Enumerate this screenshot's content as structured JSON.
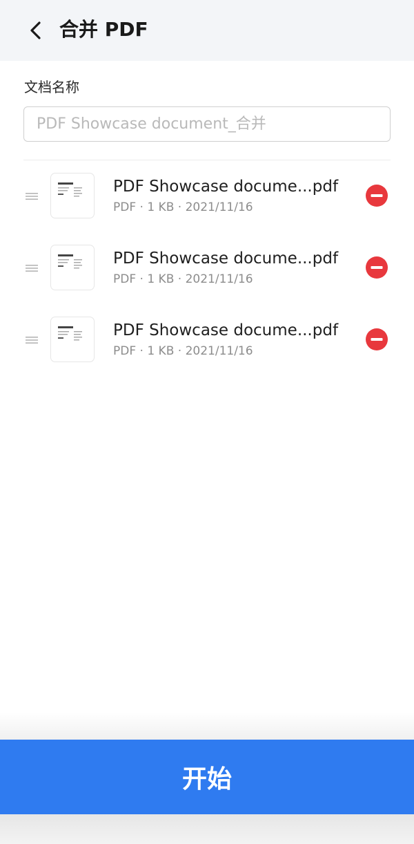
{
  "header": {
    "back_icon": "chevron-left-icon",
    "title": "合并 PDF"
  },
  "form": {
    "label": "文档名称",
    "name_placeholder": "PDF Showcase document_合并"
  },
  "files": [
    {
      "name": "PDF Showcase docume...pdf",
      "meta": "PDF · 1 KB · 2021/11/16",
      "thumb_icon": "pdf-thumbnail-icon",
      "remove_icon": "remove-circle-icon"
    },
    {
      "name": "PDF Showcase docume...pdf",
      "meta": "PDF · 1 KB · 2021/11/16",
      "thumb_icon": "pdf-thumbnail-icon",
      "remove_icon": "remove-circle-icon"
    },
    {
      "name": "PDF Showcase docume...pdf",
      "meta": "PDF · 1 KB · 2021/11/16",
      "thumb_icon": "pdf-thumbnail-icon",
      "remove_icon": "remove-circle-icon"
    }
  ],
  "actions": {
    "start_label": "开始"
  },
  "colors": {
    "primary": "#2f7bf0",
    "danger": "#e8383d",
    "header_bg": "#f3f5f8"
  }
}
